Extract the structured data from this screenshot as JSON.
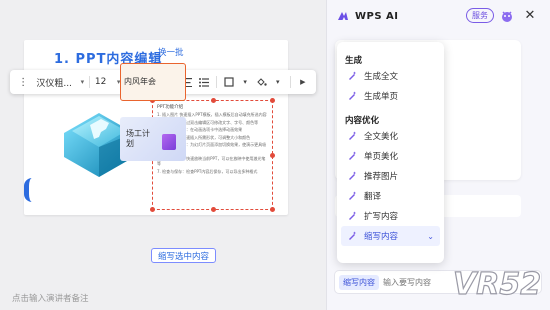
{
  "editor": {
    "slide_title": "1. PPT内容编辑",
    "textbox_heading": "PPT功能介绍",
    "paragraphs": [
      "1. 插入图片 快速插入PPT模板，插入模板后自动填充所选内容",
      "2. 编辑文本：通过双击编辑区可修改文字、字号、颜色等",
      "3. 添加动画效果：在动画选项卡中选择动画效果",
      "4. 插入形状：快速插入所需形状，可调整大小和颜色",
      "5. 添加切换效果：为幻灯片页面添加切换效果，使演示更具吸引力",
      "6. 幻灯片放映：快速放映当前PPT，可以在放映中使用激光笔等",
      "7. 检查与保存：检查PPT内容后保存，可以导出多种格式"
    ],
    "notes_placeholder": "点击输入演讲者备注"
  },
  "toolbar": {
    "font_name": "汉仪粗...",
    "font_size": "12",
    "icons": [
      "text-style-icon",
      "font-color-icon",
      "align-left-icon",
      "align-center-icon",
      "list-icon",
      "border-icon",
      "fill-icon"
    ]
  },
  "panel": {
    "title": "WPS AI",
    "service_label": "服务",
    "refresh_label": "换一批",
    "thumb_1_text": "内风年会",
    "thumb_2_text": "场工计划",
    "rewrite_selected_label": "缩写选中内容",
    "mode_chip": "缩写内容",
    "input_placeholder": "输入要写内容"
  },
  "menu": {
    "sections": [
      {
        "title": "生成",
        "items": [
          {
            "label": "生成全文"
          },
          {
            "label": "生成单页"
          }
        ]
      },
      {
        "title": "内容优化",
        "items": [
          {
            "label": "全文美化"
          },
          {
            "label": "单页美化"
          },
          {
            "label": "推荐图片"
          },
          {
            "label": "翻译"
          },
          {
            "label": "扩写内容"
          },
          {
            "label": "缩写内容",
            "active": true
          }
        ]
      }
    ]
  },
  "watermark_text": "VR52",
  "colors": {
    "accent": "#2d6cdf",
    "ai_purple": "#7a5ce6",
    "selection_red": "#e24b3b"
  }
}
